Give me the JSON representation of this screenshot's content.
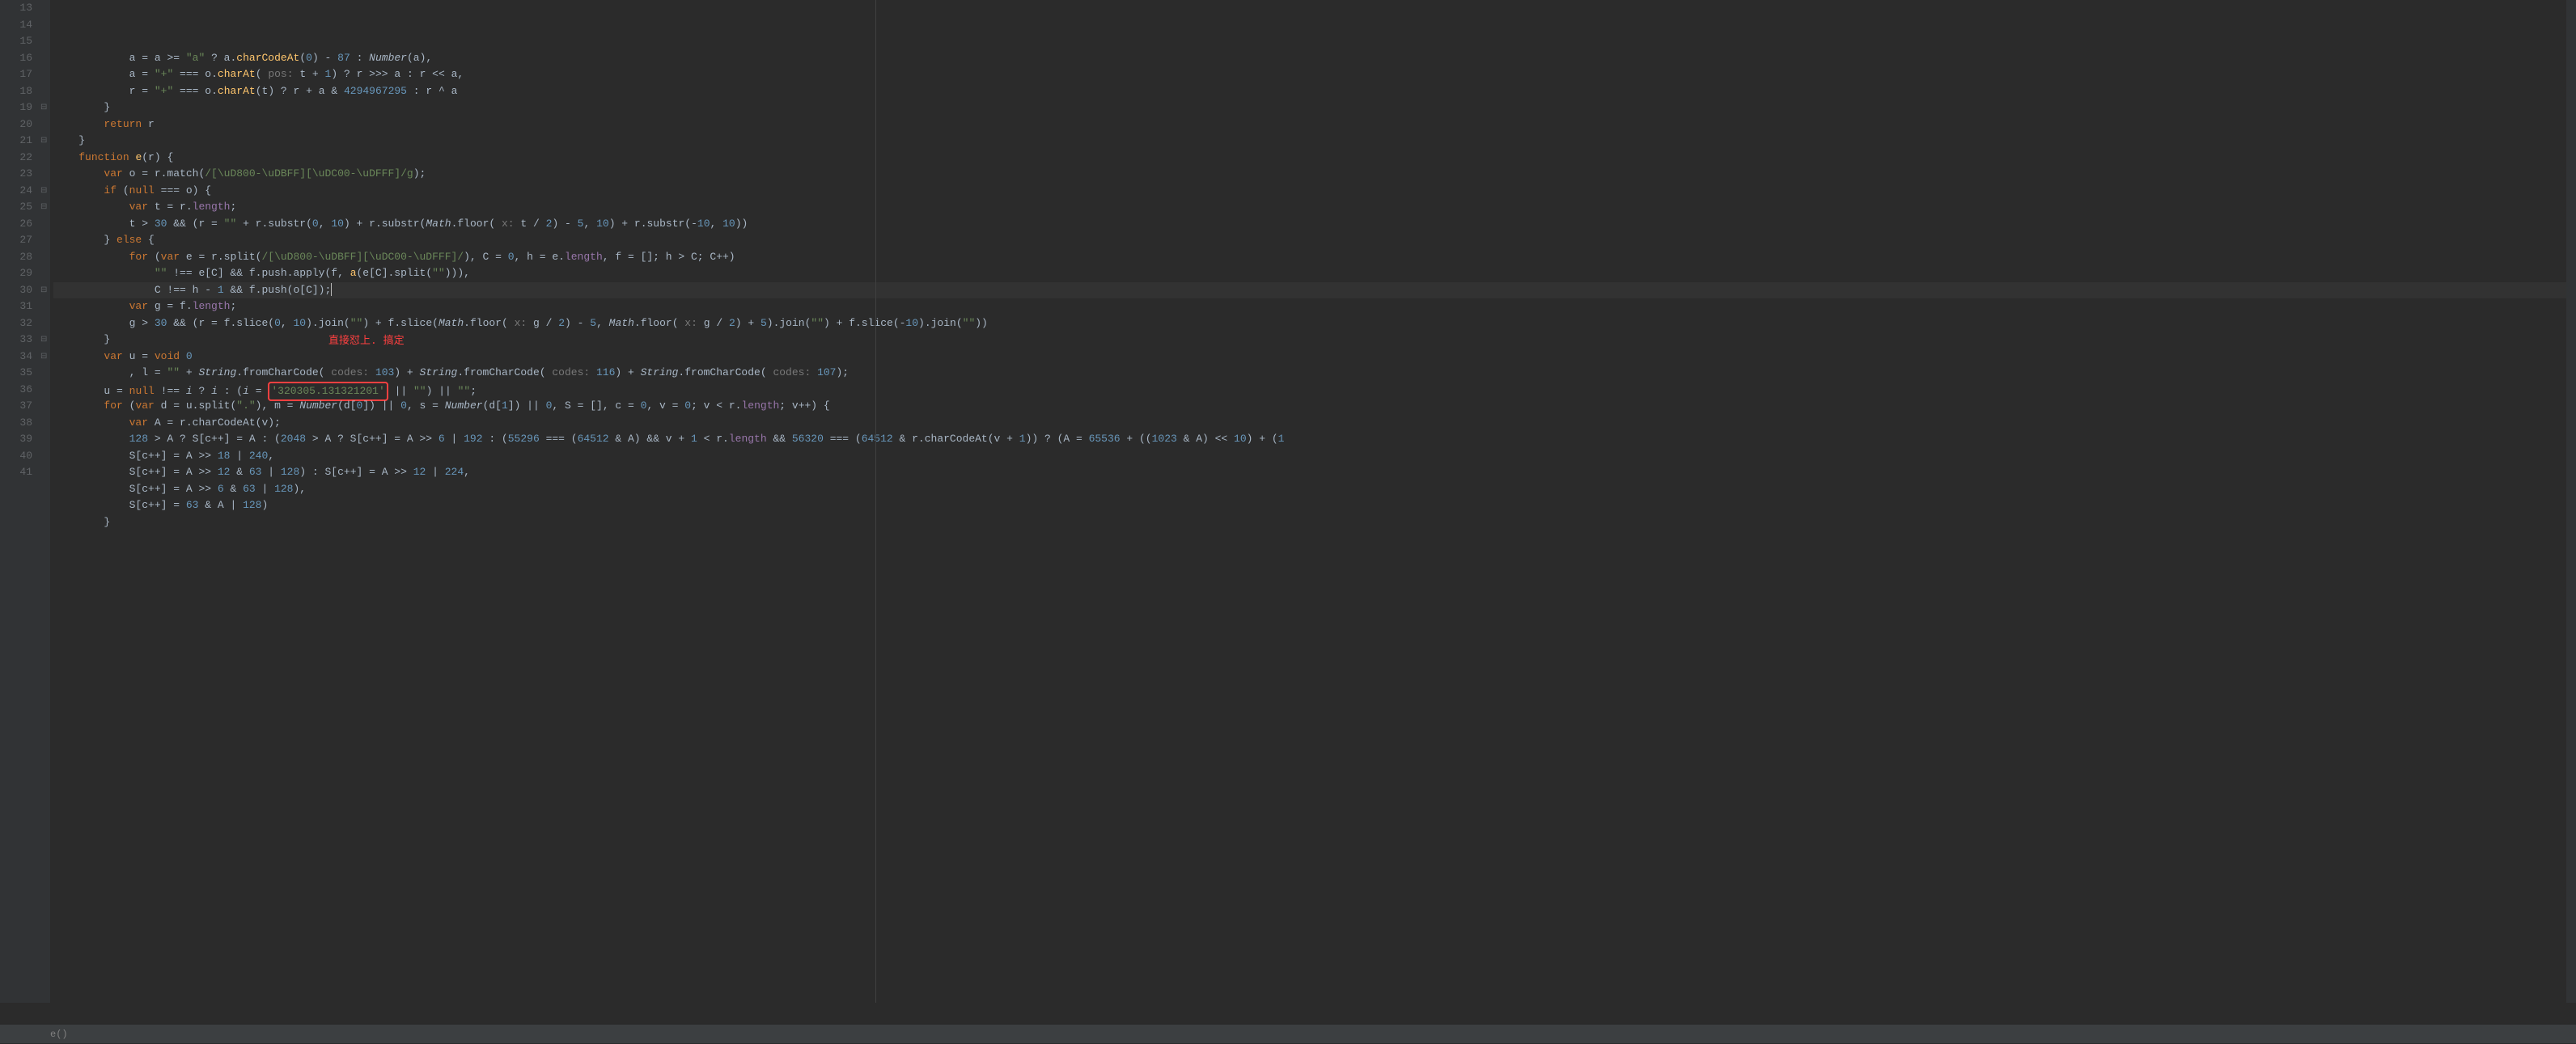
{
  "gutter": {
    "start": 13,
    "end": 41
  },
  "fold_markers": [
    {
      "line": 19,
      "type": "open"
    },
    {
      "line": 21,
      "type": "open"
    },
    {
      "line": 24,
      "type": "open"
    },
    {
      "line": 25,
      "type": "open"
    },
    {
      "line": 30,
      "type": "close"
    },
    {
      "line": 33,
      "type": "open"
    },
    {
      "line": 34,
      "type": "open"
    }
  ],
  "highlighted_line": 27,
  "code": {
    "line13": {
      "indent": "            ",
      "text": "a = a >= \"a\" ? a.charCodeAt(0) - 87 : Number(a),"
    },
    "line14": {
      "indent": "            ",
      "parts": {
        "a_eq": "a = ",
        "plus": "\"+\"",
        "eqeqeq": " === o.charAt(",
        "hint_pos": " pos: ",
        "t_plus_1": "t + ",
        "one": "1",
        "close": ") ? r >>> a : r << a,"
      }
    },
    "line15": {
      "indent": "            ",
      "parts": {
        "r_eq": "r = ",
        "plus": "\"+\"",
        "eqeqeq": " === o.charAt(t) ? r + a & ",
        "bignum": "4294967295",
        "rest": " : r ^ a"
      }
    },
    "line16": {
      "indent": "        ",
      "text": "}"
    },
    "line17": {
      "indent": "        ",
      "kw": "return",
      "text": " r"
    },
    "line18": {
      "indent": "    ",
      "text": "}"
    },
    "line19": {
      "indent": "    ",
      "kw": "function",
      "fn": " e",
      "params": "(r) {"
    },
    "line20": {
      "indent": "        ",
      "kw": "var",
      "text": " o = r.match(",
      "regex": "/[\\uD800-\\uDBFF][\\uDC00-\\uDFFF]/g",
      "close": ");"
    },
    "line21": {
      "indent": "        ",
      "kw": "if",
      "text": " (",
      "null_kw": "null",
      "rest": " === o) {"
    },
    "line22": {
      "indent": "            ",
      "kw": "var",
      "text": " t = r.",
      "prop": "length",
      "close": ";"
    },
    "line23": {
      "indent": "            ",
      "parts": {
        "t_gt": "t > ",
        "n30": "30",
        "and": " && (r = ",
        "empty": "\"\"",
        "plus_sub": " + r.substr(",
        "n0": "0",
        "comma": ", ",
        "n10": "10",
        "close1": ") + r.substr(",
        "math": "Math",
        "floor": ".floor(",
        "hint_x": " x: ",
        "t_div": "t / ",
        "n2": "2",
        "close2": ") - ",
        "n5": "5",
        "rest": ", ",
        "n10b": "10",
        "close3": ") + r.substr(-",
        "n10c": "10",
        "rest2": ", ",
        "n10d": "10",
        "final": "))"
      }
    },
    "line24": {
      "indent": "        ",
      "text": "} ",
      "kw": "else",
      "rest": " {"
    },
    "line25": {
      "indent": "            ",
      "kw": "for",
      "text": " (",
      "var_kw": "var",
      "rest": " e = r.split(",
      "regex": "/[\\uD800-\\uDBFF][\\uDC00-\\uDFFF]/",
      "close": "), C = ",
      "n0": "0",
      "comma": ", h = e.",
      "prop": "length",
      "rest2": ", f = []; h > C; C++)"
    },
    "line26": {
      "indent": "                ",
      "empty": "\"\"",
      "neq": " !== e[C] && f.push.apply(f, ",
      "fn": "a",
      "rest": "(e[C].split(",
      "empty2": "\"\"",
      "close": "))),"
    },
    "line27": {
      "indent": "                ",
      "text": "C !== h - ",
      "n1": "1",
      "rest": " && f.push(o[C]);",
      "cursor": true
    },
    "line28": {
      "indent": "            ",
      "kw": "var",
      "text": " g = f.",
      "prop": "length",
      "close": ";"
    },
    "line29": {
      "indent": "            ",
      "parts": {
        "g_gt": "g > ",
        "n30": "30",
        "and": " && (r = f.slice(",
        "n0": "0",
        "c1": ", ",
        "n10": "10",
        "join1": ").join(",
        "e1": "\"\"",
        "plus": ") + f.slice(",
        "math": "Math",
        "floor": ".floor(",
        "hint_x": " x: ",
        "g_div": "g / ",
        "n2": "2",
        "minus5": ") - ",
        "n5": "5",
        "c2": ", ",
        "math2": "Math",
        "floor2": ".floor(",
        "hint_x2": " x: ",
        "g_div2": "g / ",
        "n2b": "2",
        "plus5": ") + ",
        "n5b": "5",
        "join2": ").join(",
        "e2": "\"\"",
        "plus2": ") + f.slice(-",
        "n10b": "10",
        "join3": ").join(",
        "e3": "\"\"",
        "final": "))"
      }
    },
    "line30": {
      "indent": "        ",
      "text": "}"
    },
    "line31": {
      "indent": "        ",
      "kw": "var",
      "text": " u = ",
      "void_kw": "void",
      "sp": " ",
      "n0": "0"
    },
    "line32": {
      "indent": "            ",
      "text": ", l = ",
      "e1": "\"\"",
      "plus": " + ",
      "cls": "String",
      "fcc": ".fromCharCode(",
      "hint_codes": " codes: ",
      "n103": "103",
      "close": ") + ",
      "cls2": "String",
      "fcc2": ".fromCharCode(",
      "hint_codes2": " codes: ",
      "n116": "116",
      "close2": ") + ",
      "cls3": "String",
      "fcc3": ".fromCharCode(",
      "hint_codes3": " codes: ",
      "n107": "107",
      "final": ");"
    },
    "line33": {
      "indent": "        ",
      "text": "u = ",
      "null_kw": "null",
      "neq": " !== ",
      "i1": "i",
      "q": " ? ",
      "i2": "i",
      "colon": " : (",
      "i3": "i",
      "eq": " = ",
      "highlighted": "'320305.131321201'",
      "or1": " || ",
      "e1": "\"\"",
      "close": ") || ",
      "e2": "\"\"",
      "semi": ";"
    },
    "line34": {
      "indent": "        ",
      "kw": "for",
      "text": " (",
      "var_kw": "var",
      "rest": " d = u.split(",
      "dot": "\".\"",
      "close": "), m = ",
      "num_fn": "Number",
      "d0": "(d[",
      "n0": "0",
      "close2": "]) || ",
      "n0b": "0",
      "s_eq": ", s = ",
      "num_fn2": "Number",
      "d1": "(d[",
      "n1": "1",
      "close3": "]) || ",
      "n0c": "0",
      "rest2": ", S = [], c = ",
      "n0d": "0",
      "v_eq": ", v = ",
      "n0e": "0",
      "cond": "; v < r.",
      "prop": "length",
      "inc": "; v++) {"
    },
    "line35": {
      "indent": "            ",
      "kw": "var",
      "text": " A = r.charCodeAt(v);"
    },
    "line36": {
      "indent": "            ",
      "n128": "128",
      "gt": " > A ? S[c++] = A : (",
      "n2048": "2048",
      "gt2": " > A ? S[c++] = A >> ",
      "n6": "6",
      "or": " | ",
      "n192": "192",
      "colon": " : (",
      "n55296": "55296",
      "eqeqeq": " === (",
      "n64512": "64512",
      "and_a": " & A) && v + ",
      "n1": "1",
      "lt": " < r.",
      "prop": "length",
      "and2": " && ",
      "n56320": "56320",
      "eqeqeq2": " === (",
      "n64512b": "64512",
      "and_rc": " & r.charCodeAt(v + ",
      "n1b": "1",
      "close": ")) ? (A = ",
      "n65536": "65536",
      "plus": " + ((",
      "n1023": "1023",
      "and_a2": " & A) << ",
      "n10": "10",
      "plus2": ") + (",
      "cont": "1"
    },
    "line37": {
      "indent": "            ",
      "text": "S[c++] = A >> ",
      "n18": "18",
      "or": " | ",
      "n240": "240",
      "comma": ","
    },
    "line38": {
      "indent": "            ",
      "text": "S[c++] = A >> ",
      "n12": "12",
      "and": " & ",
      "n63": "63",
      "or": " | ",
      "n128": "128",
      "close": ") : S[c++] = A >> ",
      "n12b": "12",
      "or2": " | ",
      "n224": "224",
      "comma": ","
    },
    "line39": {
      "indent": "            ",
      "text": "S[c++] = A >> ",
      "n6": "6",
      "and": " & ",
      "n63": "63",
      "or": " | ",
      "n128": "128",
      "close": "),"
    },
    "line40": {
      "indent": "            ",
      "text": "S[c++] = ",
      "n63": "63",
      "and": " & A | ",
      "n128": "128",
      "close": ")"
    },
    "line41": {
      "indent": "        ",
      "text": "}"
    }
  },
  "annotation": {
    "text": "直接怼上. 搞定",
    "line": 30
  },
  "highlighted_string": "'320305.131321201'",
  "breadcrumb": "e()",
  "right_ruler_col": 120,
  "chart_data": null
}
